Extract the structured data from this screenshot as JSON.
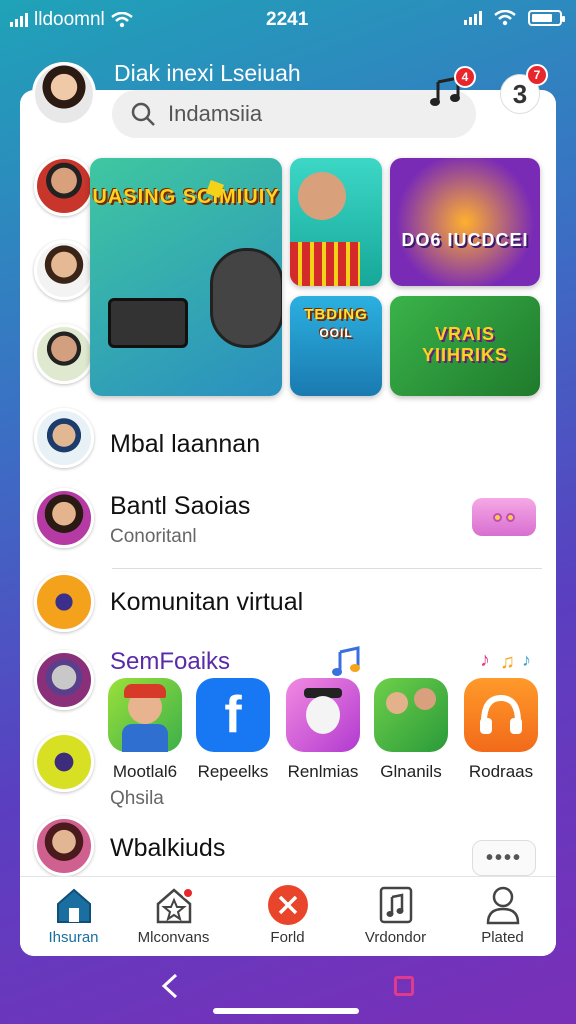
{
  "status": {
    "carrier": "lldoomnl",
    "time": "2241"
  },
  "header": {
    "title": "Diak inexi Lseiuah",
    "music_badge": "4",
    "counter_badge": "7",
    "counter_value": "3"
  },
  "search": {
    "placeholder": "Indamsiia"
  },
  "tiles": {
    "main_caption": "UASING SCIMIUIY",
    "right_top_caption": "DO6 IUCDCEI",
    "small_caption_1": "TBDING",
    "small_caption_2": "OOIL",
    "wide_caption": "VRAIS YIIHRIKS"
  },
  "rows": [
    {
      "title": "Mbal laannan",
      "subtitle": ""
    },
    {
      "title": "Bantl Saoias",
      "subtitle": "Conoritanl"
    },
    {
      "title": "Komunitan virtual",
      "subtitle": ""
    }
  ],
  "section": {
    "title": "SemFoaiks"
  },
  "apps": [
    {
      "label": "Mootlal6",
      "icon": "avatar-app-icon"
    },
    {
      "label": "Repeelks",
      "icon": "facebook-icon"
    },
    {
      "label": "Renlmias",
      "icon": "mascot-app-icon"
    },
    {
      "label": "Glnanils",
      "icon": "people-app-icon"
    },
    {
      "label": "Rodraas",
      "icon": "headphones-icon"
    }
  ],
  "footer_row": {
    "title": "Wbalkiuds",
    "subtitle": "Qhsila",
    "more": "••••"
  },
  "tabs": [
    {
      "label": "Ihsuran",
      "icon": "home-icon"
    },
    {
      "label": "Mlconvans",
      "icon": "star-house-icon"
    },
    {
      "label": "Forld",
      "icon": "close-circle-icon"
    },
    {
      "label": "Vrdondor",
      "icon": "music-file-icon"
    },
    {
      "label": "Plated",
      "icon": "person-icon"
    }
  ],
  "colors": {
    "accent": "#1b6fa0",
    "badge": "#e8262b",
    "section": "#5a2aa8"
  }
}
